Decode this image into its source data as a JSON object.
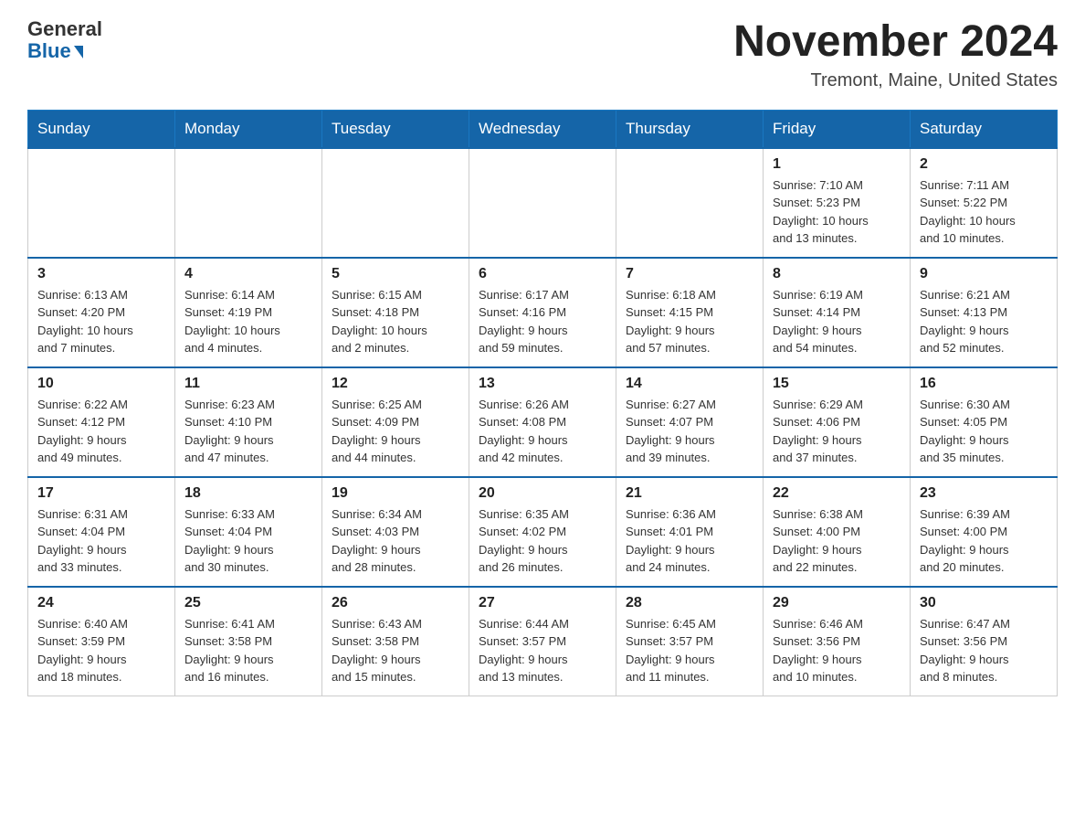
{
  "header": {
    "logo_general": "General",
    "logo_blue": "Blue",
    "month_title": "November 2024",
    "location": "Tremont, Maine, United States"
  },
  "days_of_week": [
    "Sunday",
    "Monday",
    "Tuesday",
    "Wednesday",
    "Thursday",
    "Friday",
    "Saturday"
  ],
  "weeks": [
    [
      {
        "day": "",
        "info": ""
      },
      {
        "day": "",
        "info": ""
      },
      {
        "day": "",
        "info": ""
      },
      {
        "day": "",
        "info": ""
      },
      {
        "day": "",
        "info": ""
      },
      {
        "day": "1",
        "info": "Sunrise: 7:10 AM\nSunset: 5:23 PM\nDaylight: 10 hours\nand 13 minutes."
      },
      {
        "day": "2",
        "info": "Sunrise: 7:11 AM\nSunset: 5:22 PM\nDaylight: 10 hours\nand 10 minutes."
      }
    ],
    [
      {
        "day": "3",
        "info": "Sunrise: 6:13 AM\nSunset: 4:20 PM\nDaylight: 10 hours\nand 7 minutes."
      },
      {
        "day": "4",
        "info": "Sunrise: 6:14 AM\nSunset: 4:19 PM\nDaylight: 10 hours\nand 4 minutes."
      },
      {
        "day": "5",
        "info": "Sunrise: 6:15 AM\nSunset: 4:18 PM\nDaylight: 10 hours\nand 2 minutes."
      },
      {
        "day": "6",
        "info": "Sunrise: 6:17 AM\nSunset: 4:16 PM\nDaylight: 9 hours\nand 59 minutes."
      },
      {
        "day": "7",
        "info": "Sunrise: 6:18 AM\nSunset: 4:15 PM\nDaylight: 9 hours\nand 57 minutes."
      },
      {
        "day": "8",
        "info": "Sunrise: 6:19 AM\nSunset: 4:14 PM\nDaylight: 9 hours\nand 54 minutes."
      },
      {
        "day": "9",
        "info": "Sunrise: 6:21 AM\nSunset: 4:13 PM\nDaylight: 9 hours\nand 52 minutes."
      }
    ],
    [
      {
        "day": "10",
        "info": "Sunrise: 6:22 AM\nSunset: 4:12 PM\nDaylight: 9 hours\nand 49 minutes."
      },
      {
        "day": "11",
        "info": "Sunrise: 6:23 AM\nSunset: 4:10 PM\nDaylight: 9 hours\nand 47 minutes."
      },
      {
        "day": "12",
        "info": "Sunrise: 6:25 AM\nSunset: 4:09 PM\nDaylight: 9 hours\nand 44 minutes."
      },
      {
        "day": "13",
        "info": "Sunrise: 6:26 AM\nSunset: 4:08 PM\nDaylight: 9 hours\nand 42 minutes."
      },
      {
        "day": "14",
        "info": "Sunrise: 6:27 AM\nSunset: 4:07 PM\nDaylight: 9 hours\nand 39 minutes."
      },
      {
        "day": "15",
        "info": "Sunrise: 6:29 AM\nSunset: 4:06 PM\nDaylight: 9 hours\nand 37 minutes."
      },
      {
        "day": "16",
        "info": "Sunrise: 6:30 AM\nSunset: 4:05 PM\nDaylight: 9 hours\nand 35 minutes."
      }
    ],
    [
      {
        "day": "17",
        "info": "Sunrise: 6:31 AM\nSunset: 4:04 PM\nDaylight: 9 hours\nand 33 minutes."
      },
      {
        "day": "18",
        "info": "Sunrise: 6:33 AM\nSunset: 4:04 PM\nDaylight: 9 hours\nand 30 minutes."
      },
      {
        "day": "19",
        "info": "Sunrise: 6:34 AM\nSunset: 4:03 PM\nDaylight: 9 hours\nand 28 minutes."
      },
      {
        "day": "20",
        "info": "Sunrise: 6:35 AM\nSunset: 4:02 PM\nDaylight: 9 hours\nand 26 minutes."
      },
      {
        "day": "21",
        "info": "Sunrise: 6:36 AM\nSunset: 4:01 PM\nDaylight: 9 hours\nand 24 minutes."
      },
      {
        "day": "22",
        "info": "Sunrise: 6:38 AM\nSunset: 4:00 PM\nDaylight: 9 hours\nand 22 minutes."
      },
      {
        "day": "23",
        "info": "Sunrise: 6:39 AM\nSunset: 4:00 PM\nDaylight: 9 hours\nand 20 minutes."
      }
    ],
    [
      {
        "day": "24",
        "info": "Sunrise: 6:40 AM\nSunset: 3:59 PM\nDaylight: 9 hours\nand 18 minutes."
      },
      {
        "day": "25",
        "info": "Sunrise: 6:41 AM\nSunset: 3:58 PM\nDaylight: 9 hours\nand 16 minutes."
      },
      {
        "day": "26",
        "info": "Sunrise: 6:43 AM\nSunset: 3:58 PM\nDaylight: 9 hours\nand 15 minutes."
      },
      {
        "day": "27",
        "info": "Sunrise: 6:44 AM\nSunset: 3:57 PM\nDaylight: 9 hours\nand 13 minutes."
      },
      {
        "day": "28",
        "info": "Sunrise: 6:45 AM\nSunset: 3:57 PM\nDaylight: 9 hours\nand 11 minutes."
      },
      {
        "day": "29",
        "info": "Sunrise: 6:46 AM\nSunset: 3:56 PM\nDaylight: 9 hours\nand 10 minutes."
      },
      {
        "day": "30",
        "info": "Sunrise: 6:47 AM\nSunset: 3:56 PM\nDaylight: 9 hours\nand 8 minutes."
      }
    ]
  ]
}
